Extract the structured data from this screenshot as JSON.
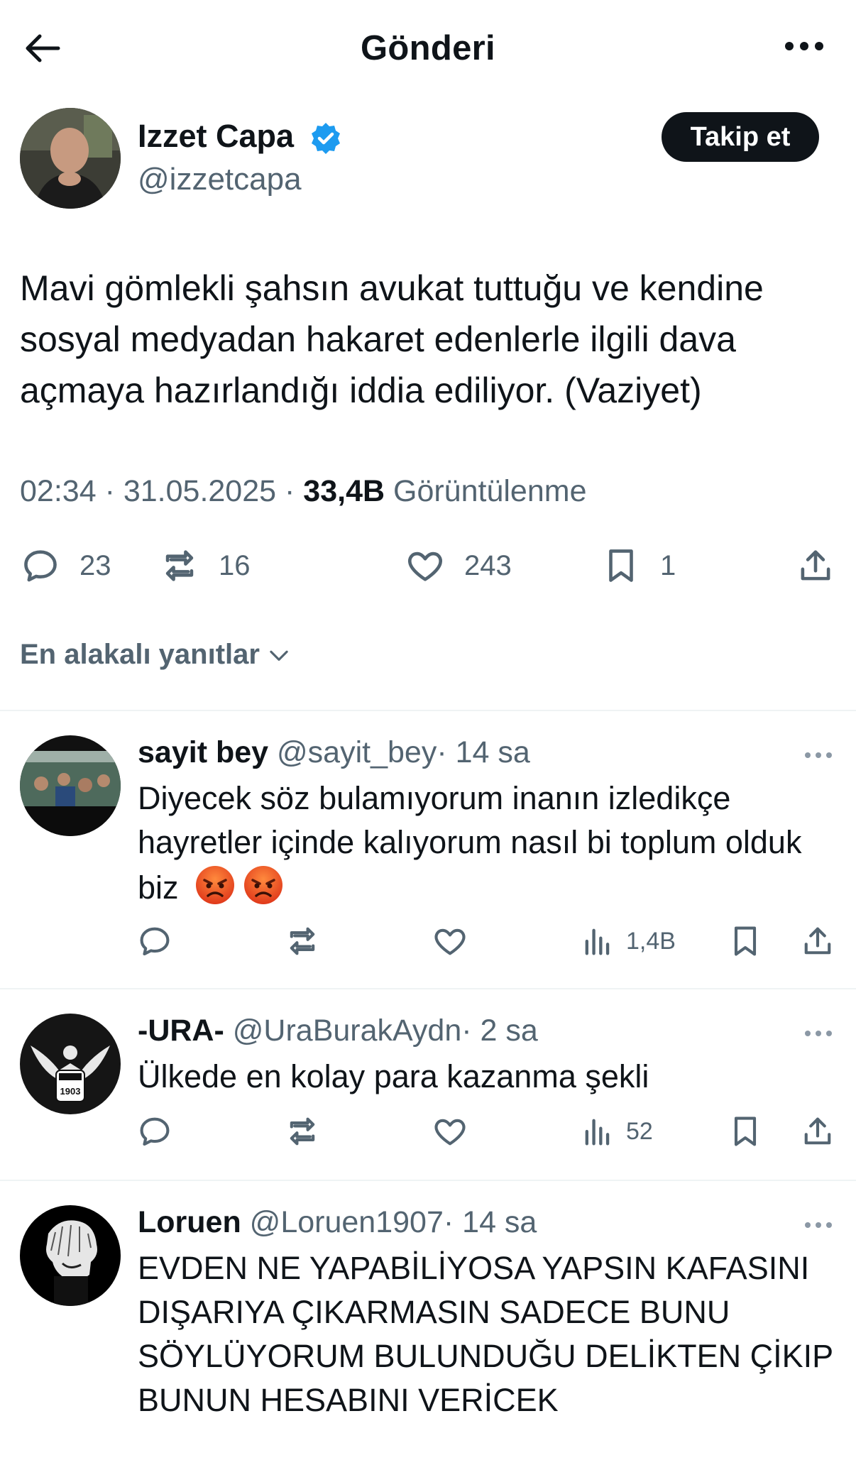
{
  "header": {
    "title": "Gönderi"
  },
  "author": {
    "name": "Izzet Capa",
    "handle": "@izzetcapa",
    "follow_label": "Takip et"
  },
  "tweet": {
    "text": "Mavi gömlekli şahsın avukat tuttuğu ve kendine sosyal medyadan hakaret edenlerle ilgili dava açmaya hazırlandığı iddia ediliyor. (Vaziyet)",
    "time": "02:34",
    "sep1": "·",
    "date": "31.05.2025",
    "sep2": "·",
    "views_count": "33,4B",
    "views_label": "Görüntülenme"
  },
  "stats": {
    "replies": "23",
    "reposts": "16",
    "likes": "243",
    "bookmarks": "1"
  },
  "sort_label": "En alakalı yanıtlar",
  "replies": [
    {
      "name": "sayit bey",
      "handle": "@sayit_bey",
      "dot": "·",
      "time": "14 sa",
      "text": "Diyecek söz bulamıyorum inanın izledikçe hayretler içinde kalıyorum nasıl bi toplum olduk biz",
      "emoji": "angry-face-emoji",
      "views": "1,4B"
    },
    {
      "name": "-URA-",
      "handle": "@UraBurakAydn",
      "dot": "·",
      "time": "2 sa",
      "text": "Ülkede en kolay para kazanma şekli",
      "views": "52"
    },
    {
      "name": "Loruen",
      "handle": "@Loruen1907",
      "dot": "·",
      "time": "14 sa",
      "text": "EVDEN NE YAPABİLİYOSA YAPSIN KAFASINI DIŞARIYA ÇIKARMASIN SADECE BUNU SÖYLÜYORUM BULUNDUĞU DELİKTEN ÇİKIP BUNUN HESABINI VERİCEK"
    }
  ],
  "colors": {
    "text": "#0f1419",
    "secondary": "#536471",
    "verified": "#1d9bf0",
    "divider": "#eff3f4"
  }
}
